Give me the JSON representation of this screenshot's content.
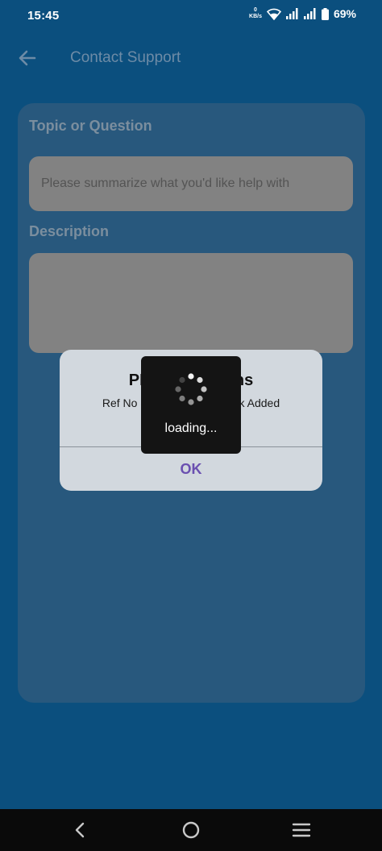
{
  "status_bar": {
    "time": "15:45",
    "net_speed_value": "0",
    "net_speed_unit": "KB/s",
    "battery": "69%"
  },
  "app_bar": {
    "title": "Contact Support",
    "back_icon": "arrow-left-icon"
  },
  "form": {
    "topic_label": "Topic or Question",
    "topic_placeholder": "Please summarize what you'd like help with",
    "description_label": "Description",
    "description_value": ""
  },
  "dialog": {
    "title": "PRAMS Citizens",
    "message": "Ref No 30000137 FeedBack Added Successfully",
    "ok_label": "OK"
  },
  "loading": {
    "text": "loading..."
  },
  "nav_bar": {
    "back_icon": "chevron-left-icon",
    "home_icon": "circle-home-icon",
    "recents_icon": "menu-lines-icon"
  },
  "colors": {
    "background": "#0b4f7e",
    "card": "#28587d",
    "field": "#828282",
    "dialog": "#d2d8de",
    "accent": "#6a4fb0"
  }
}
